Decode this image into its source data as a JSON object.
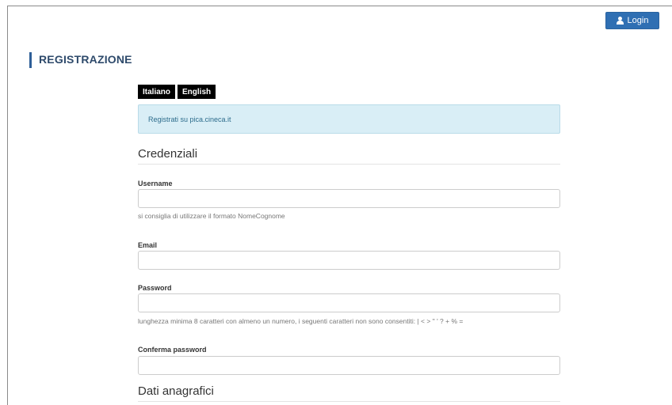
{
  "header": {
    "login_label": "Login"
  },
  "page": {
    "title": "REGISTRAZIONE",
    "languages": [
      "Italiano",
      "English"
    ],
    "info_message": "Registrati su pica.cineca.it"
  },
  "sections": {
    "credentials_title": "Credenziali",
    "personal_title": "Dati anagrafici"
  },
  "fields": {
    "username": {
      "label": "Username",
      "value": "",
      "help": "si consiglia di utilizzare il formato NomeCognome"
    },
    "email": {
      "label": "Email",
      "value": ""
    },
    "password": {
      "label": "Password",
      "value": "",
      "help": "lunghezza minima 8 caratteri con almeno un numero, i seguenti caratteri non sono consentiti: | < > \" ' ? + % ="
    },
    "confirm_password": {
      "label": "Conferma password",
      "value": ""
    }
  },
  "colors": {
    "accent": "#2f6fb3",
    "title": "#2e4a6b",
    "info_bg": "#d9eef6"
  },
  "icons": {
    "login": "user-icon"
  }
}
